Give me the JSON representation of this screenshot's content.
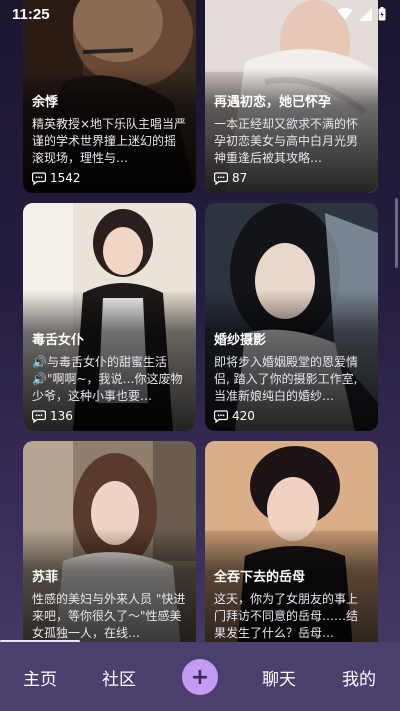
{
  "status_bar": {
    "time": "11:25"
  },
  "cards": [
    {
      "title": "余悸",
      "desc": "精英教授×地下乐队主唱当严谨的学术世界撞上迷幻的摇滚现场，理性与…",
      "count": "1542"
    },
    {
      "title": "再遇初恋，她已怀孕",
      "desc": "一本正经却又欲求不满的怀孕初恋美女与高中白月光男神重逢后被其攻略…",
      "count": "87"
    },
    {
      "title": "毒舌女仆",
      "desc": "🔊与毒舌女仆的甜蜜生活🔊\"啊啊~，我说…你这废物少爷，这种小事也要…",
      "count": "136"
    },
    {
      "title": "婚纱摄影",
      "desc": "即将步入婚姻殿堂的恩爱情侣, 踏入了你的摄影工作室, 当准新娘纯白的婚纱…",
      "count": "420"
    },
    {
      "title": "苏菲",
      "desc": "性感的美妇与外来人员 \"快进来吧，等你很久了～\"性感美女孤独一人，在线…",
      "count": ""
    },
    {
      "title": "全吞下去的岳母",
      "desc": "这天，你为了女朋友的事上门拜访不同意的岳母……结果发生了什么？岳母…",
      "count": ""
    }
  ],
  "nav": {
    "home": "主页",
    "community": "社区",
    "plus": "+",
    "chat": "聊天",
    "mine": "我的"
  },
  "icons": {
    "comment": "comment-bubble-icon",
    "wifi": "wifi-icon",
    "signal": "signal-icon",
    "battery": "battery-icon"
  }
}
